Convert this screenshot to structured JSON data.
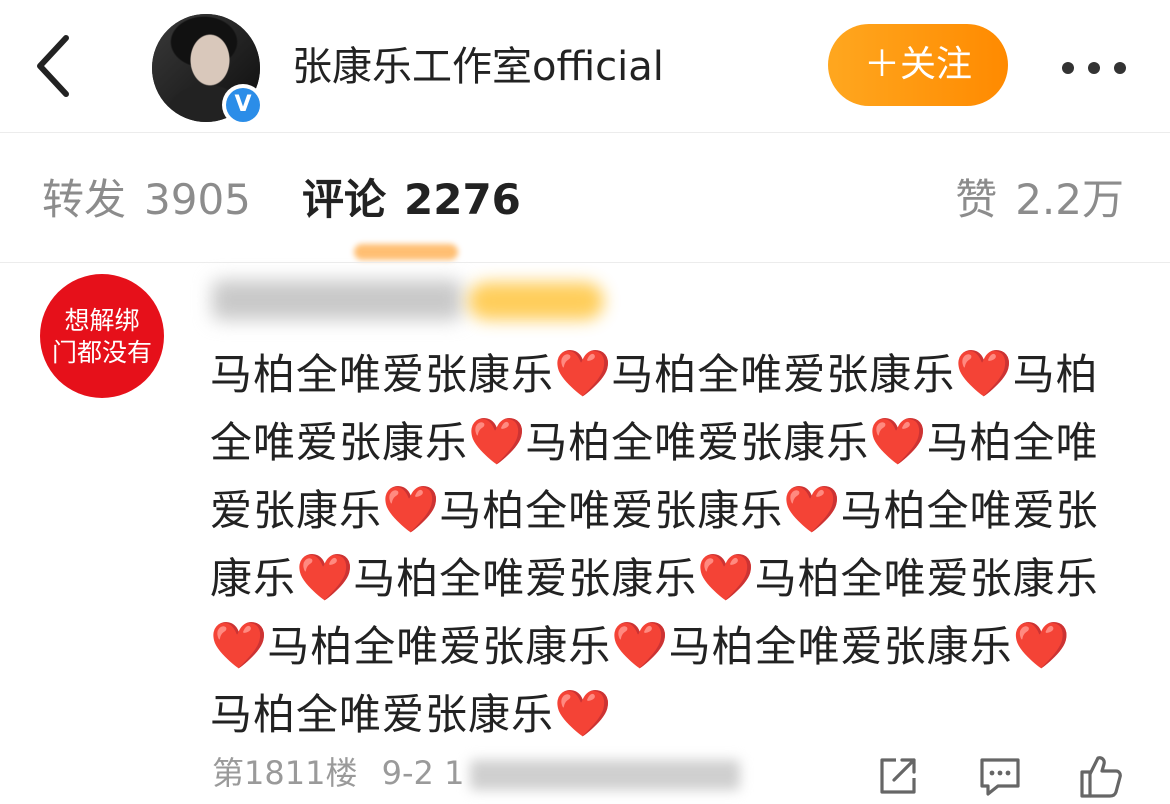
{
  "header": {
    "account_name": "张康乐工作室official",
    "follow_label": "＋关注",
    "verified_mark": "V"
  },
  "tabs": {
    "repost": {
      "label": "转发",
      "count": "3905"
    },
    "comments": {
      "label": "评论",
      "count": "2276"
    },
    "likes": {
      "label": "赞",
      "count": "2.2万"
    }
  },
  "comment": {
    "avatar_text_line1": "想解绑",
    "avatar_text_line2": "门都没有",
    "text_unit": "马柏全唯爱张康乐",
    "heart": "❤️",
    "repeat_count": 12,
    "floor": "第1811楼",
    "date": "9-2 1"
  },
  "icons": {
    "back": "chevron-left-icon",
    "more": "more-dots-icon",
    "share": "share-icon",
    "reply": "comment-icon",
    "like": "thumbs-up-icon"
  },
  "colors": {
    "follow_button": "#ff9a0f",
    "avatar_badge": "#e6101a",
    "verified": "#2b8de8",
    "heart": "#e6101a"
  }
}
